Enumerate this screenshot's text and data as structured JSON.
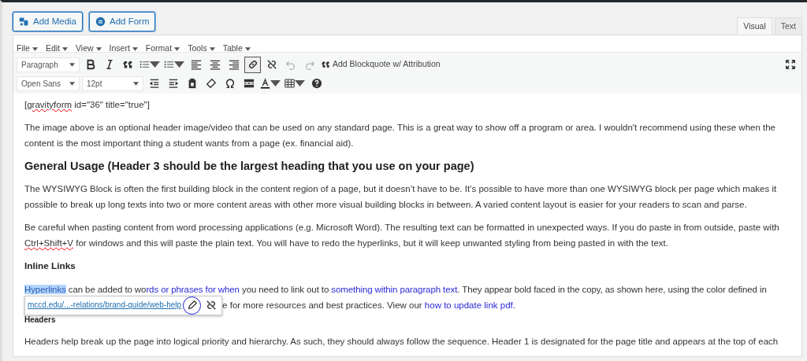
{
  "media_buttons": [
    "Add Media",
    "Add Form"
  ],
  "tabs": [
    {
      "label": "Visual",
      "selected": true
    },
    {
      "label": "Text",
      "selected": false
    }
  ],
  "menu": [
    "File",
    "Edit",
    "View",
    "Insert",
    "Format",
    "Tools",
    "Table"
  ],
  "toolbar_1": {
    "format_select": "Paragraph",
    "link_pressed": true,
    "undo_disabled": true,
    "redo_disabled": true,
    "blockquote_button": "Add Blockquote w/ Attribution"
  },
  "toolbar_2": {
    "font_select": "Open Sans",
    "size_select": "12pt"
  },
  "content": [
    {
      "kind": "paragraph",
      "segments": [
        {
          "text": "["
        },
        {
          "text": "gravityform",
          "misspelled": true
        },
        {
          "text": " id=\"36\" title=\"true\"]"
        }
      ]
    },
    {
      "kind": "paragraph",
      "segments": [
        {
          "text": "The image above is an optional header image/video that can be used on any standard page. This is a great way to show off a program or area. I wouldn't recommend using these when the content is the most important thing a student wants from a page (ex. financial aid)."
        }
      ]
    },
    {
      "kind": "heading",
      "text": "General Usage (Header 3 should be the largest heading that you use on your page)"
    },
    {
      "kind": "paragraph",
      "segments": [
        {
          "text": "The WYSIWYG Block is often the first building block in the content region of a page, but it doesn’t have to be. It’s possible to have more than one WYSIWYG block per page which makes it possible to break up long texts into two or more content areas with other more visual building blocks in between. A varied content layout is easier for your readers to scan and parse."
        }
      ]
    },
    {
      "kind": "paragraph",
      "segments": [
        {
          "text": "Be careful when pasting content from word processing applications (e.g. Microsoft Word). The resulting text can be formatted in unexpected ways. If you do paste in from outside, paste with "
        },
        {
          "text": "Ctrl+Shift+V",
          "misspelled": true
        },
        {
          "text": " for windows and this will paste the plain text. You will have to redo the hyperlinks, but it will keep unwanted styling from being pasted in with the text."
        }
      ]
    },
    {
      "kind": "subheading",
      "text": "Inline Links"
    },
    {
      "kind": "link-paragraph",
      "line_1": [
        {
          "text": "Hyperlinks",
          "selected": true
        },
        {
          "text": " can be added to wo"
        },
        {
          "text": "rds or phrases for when",
          "link": true
        },
        {
          "text": " you need to link out to "
        },
        {
          "text": "something within paragraph text",
          "link": true
        },
        {
          "text": ". They appear bold faced in the copy, as shown here, using the color defined in"
        }
      ],
      "popup": {
        "url": "mccd.edu/...-relations/brand-guide/web-help",
        "edit_circled": true
      },
      "line_2": [
        {
          "text": "e for more resources and best practices. View our "
        },
        {
          "text": "how to update link pdf",
          "link": true
        },
        {
          "text": "."
        }
      ]
    },
    {
      "kind": "small-heading",
      "text": "Headers"
    },
    {
      "kind": "paragraph",
      "segments": [
        {
          "text": "Headers help break up the page into logical priority and hierarchy. As such, they should always follow the sequence. Header 1 is designated for the page title and appears at the top of each"
        }
      ]
    }
  ]
}
